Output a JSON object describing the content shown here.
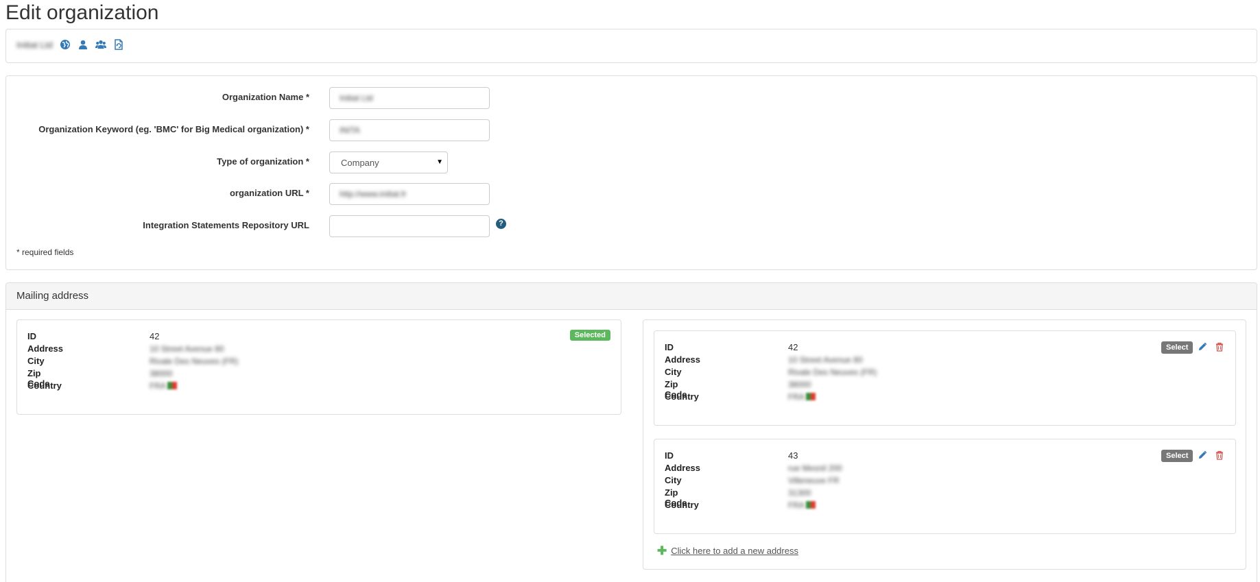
{
  "page": {
    "title": "Edit organization"
  },
  "toolbar": {
    "org_name_blurred": "Initiat Ltd",
    "icons": [
      "globe-icon",
      "user-icon",
      "users-icon",
      "document-refresh-icon"
    ]
  },
  "form": {
    "organization_name": {
      "label": "Organization Name *",
      "value": "Initiat Ltd"
    },
    "keyword": {
      "label": "Organization Keyword (eg. 'BMC' for Big Medical organization) *",
      "value": "INITA"
    },
    "type": {
      "label": "Type of organization *",
      "value": "Company"
    },
    "url": {
      "label": "organization URL *",
      "value": "http://www.initiat.fr"
    },
    "integration_url": {
      "label": "Integration Statements Repository URL",
      "value": "",
      "help": "?"
    },
    "required_note": "* required fields"
  },
  "mailing": {
    "heading": "Mailing address",
    "field_labels": {
      "id": "ID",
      "address": "Address",
      "city": "City",
      "zip": "Zip Code",
      "country": "Country"
    },
    "selected_badge": "Selected",
    "select_label": "Select",
    "selected_address": {
      "id": "42",
      "address": "10 Street Avenue 80",
      "city": "Rivale Des Neuves (FR)",
      "zip": "38000",
      "country": "FRA"
    },
    "addresses": [
      {
        "id": "42",
        "address": "10 Street Avenue 80",
        "city": "Rivale Des Neuves (FR)",
        "zip": "38000",
        "country": "FRA"
      },
      {
        "id": "43",
        "address": "rue Mesnil 200",
        "city": "Villeneuve FR",
        "zip": "31300",
        "country": "FRA"
      }
    ],
    "add_link": "Click here to add a new address"
  },
  "colors": {
    "selected_badge": "#5cb85c",
    "select_button": "#777777",
    "icon_blue": "#337ab7",
    "delete_red": "#d9534f",
    "plus_green": "#5cb85c"
  }
}
